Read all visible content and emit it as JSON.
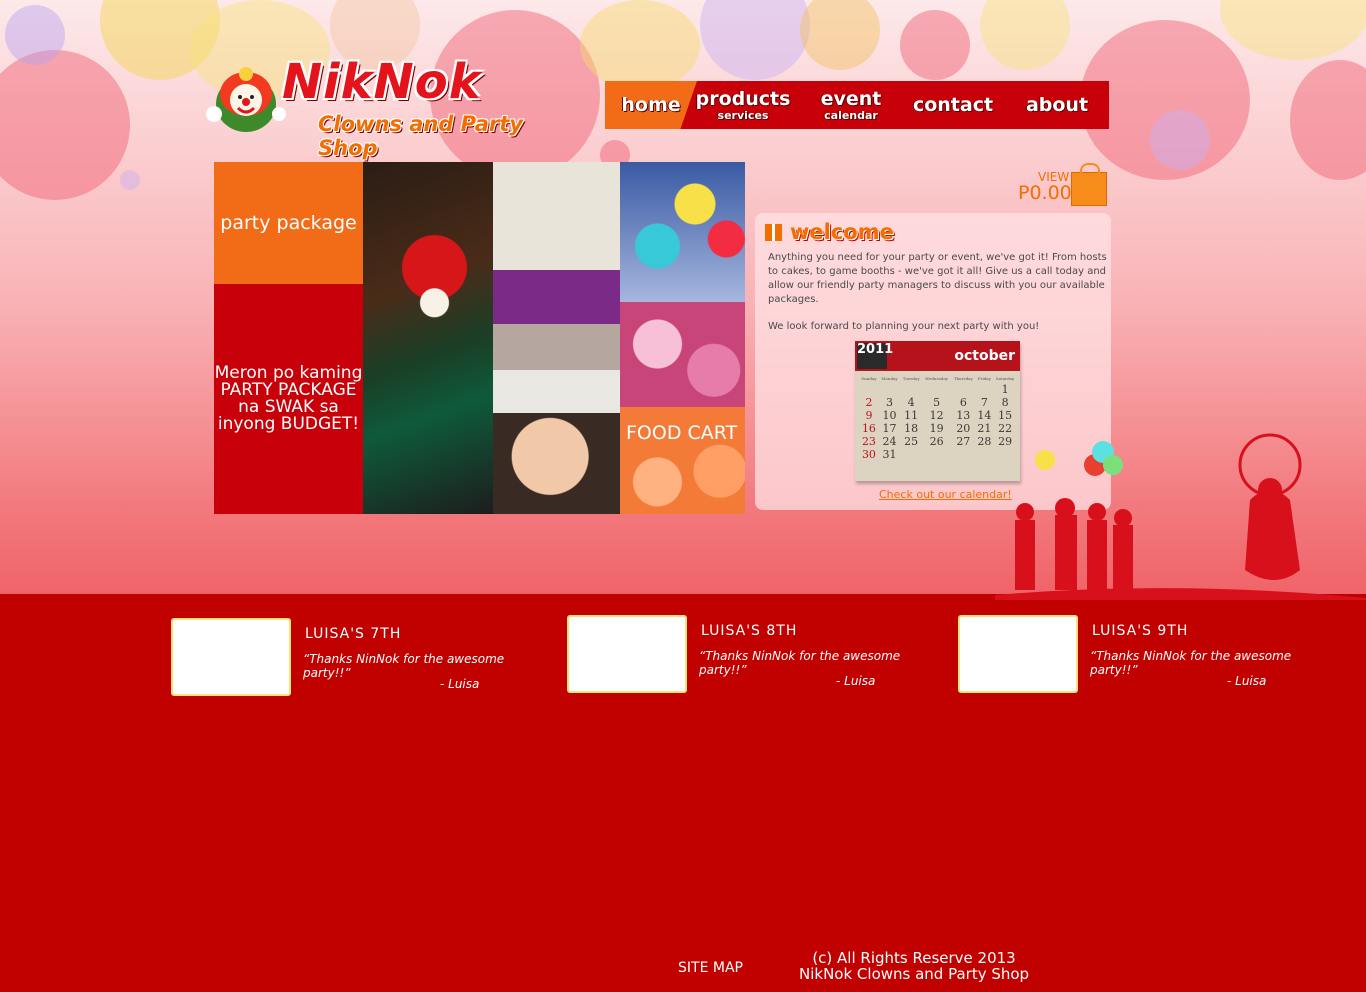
{
  "brand": {
    "name": "NikNok",
    "tagline": "Clowns and Party Shop"
  },
  "nav": [
    {
      "label": "home",
      "sub": ""
    },
    {
      "label": "products",
      "sub": "services"
    },
    {
      "label": "event",
      "sub": "calendar"
    },
    {
      "label": "contact",
      "sub": ""
    },
    {
      "label": "about",
      "sub": ""
    }
  ],
  "cart": {
    "view_label": "VIEW",
    "amount": "P0.00"
  },
  "mosaic": {
    "party_package": "party package",
    "promo": "Meron po kaming PARTY PACKAGE na SWAK sa inyong BUDGET!",
    "food_cart": "FOOD CART"
  },
  "welcome": {
    "title": "welcome",
    "paragraph1": "Anything you need for your party or event, we've got it! From hosts to cakes, to game booths - we've got it all! Give us a call today and allow our friendly party managers to discuss with you our available packages.",
    "paragraph2": "We look forward to planning your next party with you!",
    "calendar": {
      "year": "2011",
      "month": "october",
      "weekdays": [
        "Sunday",
        "Monday",
        "Tuesday",
        "Wednesday",
        "Thursday",
        "Friday",
        "Saturday"
      ],
      "weeks": [
        [
          "",
          "",
          "",
          "",
          "",
          "",
          "1"
        ],
        [
          "2",
          "3",
          "4",
          "5",
          "6",
          "7",
          "8"
        ],
        [
          "9",
          "10",
          "11",
          "12",
          "13",
          "14",
          "15"
        ],
        [
          "16",
          "17",
          "18",
          "19",
          "20",
          "21",
          "22"
        ],
        [
          "23",
          "24",
          "25",
          "26",
          "27",
          "28",
          "29"
        ],
        [
          "30",
          "31",
          "",
          "",
          "",
          "",
          ""
        ]
      ]
    },
    "calendar_link": "Check out our calendar!"
  },
  "testimonials": [
    {
      "title": "LUISA'S 7TH",
      "quote": "“Thanks NinNok for the awesome party!!”",
      "author": "- Luisa"
    },
    {
      "title": "LUISA'S 8TH",
      "quote": "“Thanks NinNok for the awesome party!!”",
      "author": "- Luisa"
    },
    {
      "title": "LUISA'S 9TH",
      "quote": "“Thanks NinNok for the awesome party!!”",
      "author": "- Luisa"
    }
  ],
  "footer": {
    "sitemap": "SITE MAP",
    "copyright_line1": "(c) All Rights Reserve 2013",
    "copyright_line2": "NikNok Clowns and Party Shop"
  },
  "colors": {
    "primary_red": "#c70009",
    "accent_orange": "#f26c17",
    "footer_red": "#c10000"
  }
}
